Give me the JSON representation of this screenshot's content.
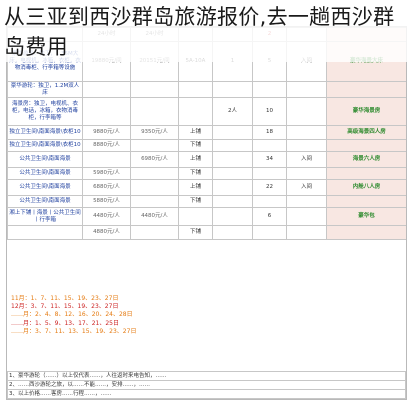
{
  "page": {
    "title": "从三亚到西沙群岛旅游报价,去一趟西沙群岛费用"
  },
  "rows": [
    {
      "col1": "",
      "col2": "24小时",
      "col3": "24小时",
      "col4": "",
      "col5": "",
      "col6": "2",
      "col7": "",
      "col8": ""
    },
    {
      "col1": "豪华游轮：独卫，1.35M大床，电视机，冰箱，衣柜，衣物消毒柜、行李箱等设施",
      "col2": "19880元/间",
      "col3": "20151元/间",
      "col4": "5A-10A",
      "col5": "1",
      "col6": "5",
      "col7": "入间",
      "col8": "豪华海景大床"
    },
    {
      "col1": "豪华游轮：独卫，1.2M双人床",
      "col2": "",
      "col3": "",
      "col4": "",
      "col5": "",
      "col6": "",
      "col7": "",
      "col8": ""
    },
    {
      "col1": "海景房：独卫，电视机、衣柜，电话，冰箱，衣物消毒柜，行李箱等",
      "col2": "",
      "col3": "",
      "col4": "",
      "col5": "2人",
      "col6": "10",
      "col7": "",
      "col8": "豪华海景房"
    },
    {
      "col1": "独立卫生间\\南面海景\\衣柜10",
      "col2": "9880元/人",
      "col3": "9350元/人",
      "col4": "上铺",
      "col5": "",
      "col6": "18",
      "col7": "",
      "col8": "高级海景四人房"
    },
    {
      "col1": "独立卫生间\\南面海景\\衣柜10",
      "col2": "8880元/人",
      "col3": "",
      "col4": "下铺",
      "col5": "",
      "col6": "",
      "col7": "",
      "col8": ""
    },
    {
      "col1": "公共卫生间\\南面海景",
      "col2": "",
      "col3": "6980元/人",
      "col4": "上铺",
      "col5": "",
      "col6": "34",
      "col7": "入间",
      "col8": "海景六人房"
    },
    {
      "col1": "公共卫生间\\南面海景",
      "col2": "5980元/人",
      "col3": "",
      "col4": "下铺",
      "col5": "",
      "col6": "",
      "col7": "",
      "col8": ""
    },
    {
      "col1": "公共卫生间\\南面海景",
      "col2": "6880元/人",
      "col3": "",
      "col4": "上铺",
      "col5": "",
      "col6": "22",
      "col7": "入间",
      "col8": "内舱八人房"
    },
    {
      "col1": "公共卫生间\\南面海景",
      "col2": "5880元/人",
      "col3": "",
      "col4": "下铺",
      "col5": "",
      "col6": "",
      "col7": "",
      "col8": ""
    },
    {
      "col1": "湘上下铺丨海景丨公共卫生间丨行李箱",
      "col2": "4480元/人",
      "col3": "4480元/人",
      "col4": "",
      "col5": "",
      "col6": "6",
      "col7": "",
      "col8": "豪华包"
    },
    {
      "col1": "",
      "col2": "4880元/人",
      "col3": "",
      "col4": "下铺",
      "col5": "",
      "col6": "",
      "col7": "",
      "col8": ""
    }
  ],
  "notes": [
    "11月：1、7、11、15、19、23、27日",
    "12月：3、7、11、15、19、23、27日",
    "……月：2、4、8、12、16、20、24、28日",
    "……月：1、5、9、13、17、21、25日",
    "……月：3、7、11、13、15、19、23、27日"
  ],
  "bottom": [
    "1、豪华游轮（……）以上仅代表……，人往返时来电告知，……",
    "2、……西沙游轮之旅，以……不能……，安排……，……",
    "3、以上价格……客房……行程……，……",
    "4、……以上价格……0……10……",
    "5、……"
  ]
}
